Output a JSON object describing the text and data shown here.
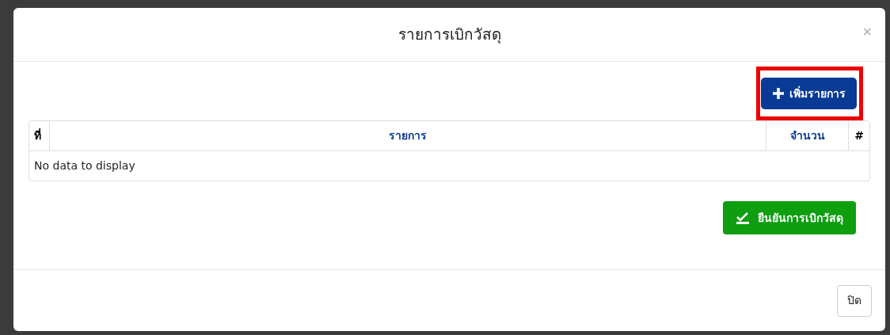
{
  "modal": {
    "title": "รายการเบิกวัสดุ",
    "close_symbol": "×"
  },
  "add_button": {
    "label": "เพิ่มรายการ",
    "highlighted": true
  },
  "table": {
    "columns": [
      "ที่",
      "รายการ",
      "จำนวน",
      "#"
    ],
    "empty_text": "No data to display"
  },
  "confirm_button": {
    "label": "ยืนยันการเบิกวัสดุ"
  },
  "footer": {
    "close_button": "ปิด"
  }
}
